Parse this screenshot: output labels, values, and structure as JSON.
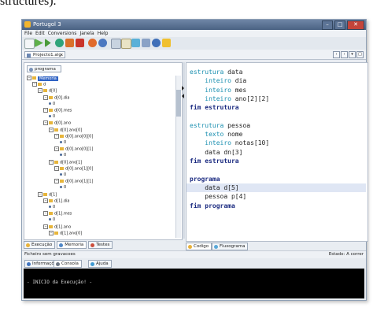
{
  "caption": "structures).",
  "window": {
    "title": "Portugol 3"
  },
  "menu": [
    "File",
    "Edit",
    "Conversions",
    "Janela",
    "Help"
  ],
  "doc_tab": {
    "label": "Projecto1.alg",
    "close": "x"
  },
  "left_tab": "programa",
  "tree": [
    {
      "label": "Memoria",
      "kind": "folder",
      "indent": 0,
      "selected": true
    },
    {
      "label": "d",
      "kind": "folder",
      "indent": 1
    },
    {
      "label": "d[0]",
      "kind": "folder",
      "indent": 2
    },
    {
      "label": "d[0].dia",
      "kind": "folder",
      "indent": 3
    },
    {
      "label": "0",
      "kind": "value",
      "indent": 4
    },
    {
      "label": "d[0].mes",
      "kind": "folder",
      "indent": 3
    },
    {
      "label": "0",
      "kind": "value",
      "indent": 4
    },
    {
      "label": "d[0].ano",
      "kind": "folder",
      "indent": 3
    },
    {
      "label": "d[0].ano[0]",
      "kind": "folder",
      "indent": 4
    },
    {
      "label": "d[0].ano[0][0]",
      "kind": "folder",
      "indent": 5
    },
    {
      "label": "0",
      "kind": "value",
      "indent": 6
    },
    {
      "label": "d[0].ano[0][1]",
      "kind": "folder",
      "indent": 5
    },
    {
      "label": "0",
      "kind": "value",
      "indent": 6
    },
    {
      "label": "d[0].ano[1]",
      "kind": "folder",
      "indent": 4
    },
    {
      "label": "d[0].ano[1][0]",
      "kind": "folder",
      "indent": 5
    },
    {
      "label": "0",
      "kind": "value",
      "indent": 6
    },
    {
      "label": "d[0].ano[1][1]",
      "kind": "folder",
      "indent": 5
    },
    {
      "label": "0",
      "kind": "value",
      "indent": 6
    },
    {
      "label": "d[1]",
      "kind": "folder",
      "indent": 2
    },
    {
      "label": "d[1].dia",
      "kind": "folder",
      "indent": 3
    },
    {
      "label": "0",
      "kind": "value",
      "indent": 4
    },
    {
      "label": "d[1].mes",
      "kind": "folder",
      "indent": 3
    },
    {
      "label": "0",
      "kind": "value",
      "indent": 4
    },
    {
      "label": "d[1].ano",
      "kind": "folder",
      "indent": 3
    },
    {
      "label": "d[1].ano[0]",
      "kind": "folder",
      "indent": 4
    }
  ],
  "left_bottom_tabs": [
    "Execução",
    "Memoria",
    "Testes"
  ],
  "code": [
    [
      {
        "t": "estrutura ",
        "c": "kw"
      },
      {
        "t": "data",
        "c": "tx"
      }
    ],
    [
      {
        "t": "    inteiro ",
        "c": "kw"
      },
      {
        "t": "dia",
        "c": "tx"
      }
    ],
    [
      {
        "t": "    inteiro ",
        "c": "kw"
      },
      {
        "t": "mes",
        "c": "tx"
      }
    ],
    [
      {
        "t": "    inteiro ",
        "c": "kw"
      },
      {
        "t": "ano[2][2]",
        "c": "tx"
      }
    ],
    [
      {
        "t": "fim estrutura",
        "c": "kwb"
      }
    ],
    [],
    [
      {
        "t": "estrutura ",
        "c": "kw"
      },
      {
        "t": "pessoa",
        "c": "tx"
      }
    ],
    [
      {
        "t": "    texto ",
        "c": "kw"
      },
      {
        "t": "nome",
        "c": "tx"
      }
    ],
    [
      {
        "t": "    inteiro ",
        "c": "kw"
      },
      {
        "t": "notas[10]",
        "c": "tx"
      }
    ],
    [
      {
        "t": "    data dn[3]",
        "c": "tx"
      }
    ],
    [
      {
        "t": "fim estrutura",
        "c": "kwb"
      }
    ],
    [],
    [
      {
        "t": "programa",
        "c": "kwb"
      }
    ],
    [
      {
        "t": "    data d[5]",
        "c": "tx"
      }
    ],
    [
      {
        "t": "    pessoa p[4]",
        "c": "tx"
      }
    ],
    [
      {
        "t": "fim programa",
        "c": "kwb"
      }
    ]
  ],
  "highlight_line": 13,
  "code_tabs": [
    "Codigo",
    "Fluxograma"
  ],
  "status": {
    "left": "Ficheiro sem gravacoes",
    "right": "Estado: A correr"
  },
  "console_tabs": [
    "Informações",
    "Consola",
    "Ajuda"
  ],
  "console_text": "- INICIO da Execução! -",
  "colors": {
    "keyword": "#1a8fb0",
    "keyword_bold": "#1a2a80",
    "selection": "#2f63c4",
    "highlight": "#dfe6f4"
  }
}
